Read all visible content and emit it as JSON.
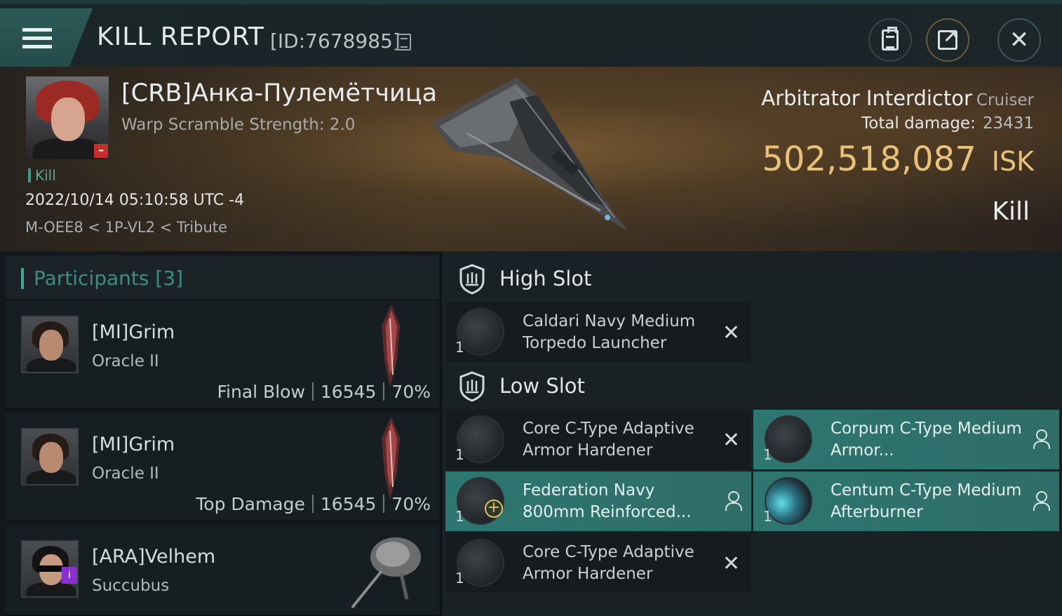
{
  "window": {
    "title": "KILL REPORT",
    "report_id": "[ID:7678985]"
  },
  "victim": {
    "name": "[CRB]Анка-Пулемётчица",
    "warp_scramble": "Warp Scramble Strength: 2.0",
    "kill_tag": "Kill",
    "timestamp": "2022/10/14 05:10:58 UTC -4",
    "location": "M-OEE8 < 1P-VL2 < Tribute",
    "ship_name": "Arbitrator Interdictor",
    "ship_class": "Cruiser",
    "total_damage_label": "Total damage:",
    "total_damage": "23431",
    "isk_value": "502,518,087",
    "isk_unit": "ISK",
    "result": "Kill"
  },
  "participants": {
    "label": "Participants [3]",
    "rows": [
      {
        "name": "[MI]Grim",
        "ship": "Oracle II",
        "role": "Final Blow",
        "damage": "16545",
        "percent": "70%"
      },
      {
        "name": "[MI]Grim",
        "ship": "Oracle II",
        "role": "Top Damage",
        "damage": "16545",
        "percent": "70%"
      },
      {
        "name": "[ARA]Velhem",
        "ship": "Succubus",
        "role": "",
        "damage": "",
        "percent": ""
      }
    ]
  },
  "fitting": {
    "high_slot_label": "High Slot",
    "low_slot_label": "Low Slot",
    "high": [
      {
        "qty": "1",
        "name": "Caldari Navy Medium Torpedo Launcher",
        "state": "destroyed"
      }
    ],
    "low": [
      {
        "qty": "1",
        "name": "Core C-Type Adaptive Armor Hardener",
        "state": "destroyed"
      },
      {
        "qty": "1",
        "name": "Corpum C-Type Medium Armor...",
        "state": "dropped"
      },
      {
        "qty": "1",
        "name": "Federation Navy 800mm Reinforced...",
        "state": "dropped"
      },
      {
        "qty": "1",
        "name": "Centum C-Type Medium Afterburner",
        "state": "dropped"
      },
      {
        "qty": "1",
        "name": "Core C-Type Adaptive Armor Hardener",
        "state": "destroyed"
      }
    ]
  },
  "colors": {
    "accent": "#3fa79a",
    "isk": "#e9c27a",
    "dropped_highlight": "#2e7670"
  }
}
